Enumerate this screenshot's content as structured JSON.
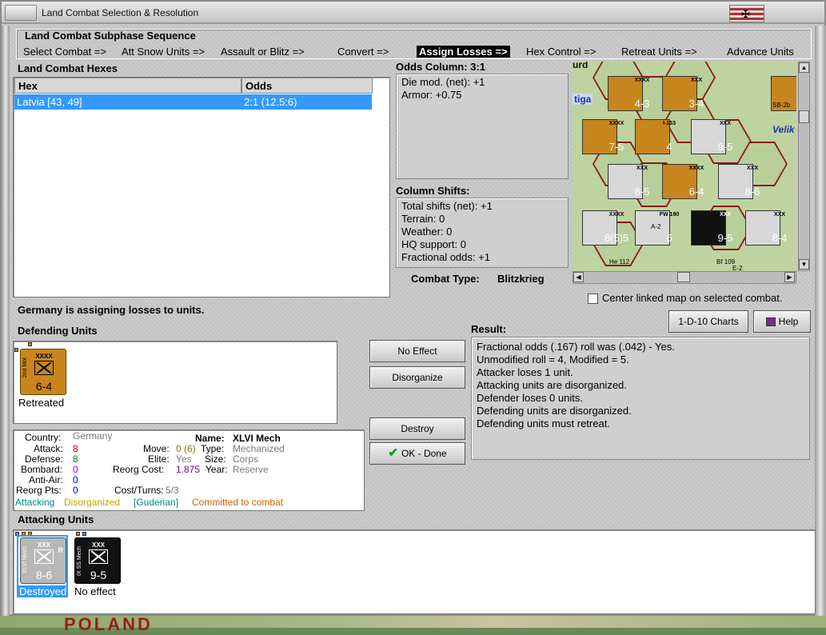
{
  "window": {
    "title": "Land Combat Selection & Resolution",
    "flag_symbol": "✠"
  },
  "sequence": {
    "title": "Land Combat Subphase Sequence",
    "steps": [
      "Select Combat =>",
      "Att Snow Units =>",
      "Assault or Blitz =>",
      "Convert =>",
      "Assign Losses =>",
      "Hex Control =>",
      "Retreat Units =>",
      "Advance Units"
    ],
    "active_step": "Assign Losses =>"
  },
  "hexes": {
    "title": "Land Combat Hexes",
    "columns": [
      "Hex",
      "Odds"
    ],
    "rows": [
      {
        "hex": "Latvia [43, 49]",
        "odds": "2:1 (12.5:6)"
      }
    ]
  },
  "odds": {
    "title": "Odds Column: 3:1",
    "lines": [
      "Die mod. (net): +1",
      "Armor: +0.75"
    ]
  },
  "shifts": {
    "title": "Column Shifts:",
    "lines": [
      "Total shifts (net): +1",
      "Terrain: 0",
      "Weather: 0",
      "HQ support: 0",
      "Fractional odds: +1"
    ]
  },
  "combat_type": {
    "label": "Combat Type:",
    "value": "Blitzkrieg"
  },
  "status_message": "Germany is assigning losses to units.",
  "map": {
    "center_checkbox_label": "Center linked map on selected combat.",
    "place_labels": [
      "Velik",
      "tiga",
      "urd"
    ],
    "units": [
      {
        "type": "XXXX",
        "value": "4-3",
        "color": "#c8861e"
      },
      {
        "type": "XXX",
        "value": "3-4",
        "color": "#c8861e"
      },
      {
        "type": "XXX",
        "value": "2",
        "color": "#c8861e"
      },
      {
        "type": "XXXX",
        "value": "7-5",
        "color": "#c8861e"
      },
      {
        "type": "I-153",
        "value": "4",
        "color": "#c8861e"
      },
      {
        "type": "XXX",
        "value": "9-5",
        "color": "#d8d8d8"
      },
      {
        "type": "XXX",
        "value": "8-5",
        "color": "#d8d8d8"
      },
      {
        "type": "XXXX",
        "value": "6-4",
        "color": "#c8861e"
      },
      {
        "type": "XXX",
        "value": "8-6",
        "color": "#d8d8d8"
      },
      {
        "type": "XXXX",
        "value": "8(5)5",
        "color": "#d8d8d8"
      },
      {
        "type": "FW 190",
        "value": "6",
        "color": "#d8d8d8"
      },
      {
        "type": "XXX",
        "value": "9-5",
        "color": "#111111"
      },
      {
        "type": "XXX",
        "value": "8-4",
        "color": "#d8d8d8"
      }
    ],
    "air_labels": [
      "He 112",
      "Bf 109",
      "A-2",
      "E-2",
      "SB-2b"
    ]
  },
  "buttons": {
    "charts": "1-D-10 Charts",
    "help": "Help",
    "no_effect": "No Effect",
    "disorganize": "Disorganize",
    "destroy": "Destroy",
    "ok_done": "OK - Done"
  },
  "defending": {
    "title": "Defending Units",
    "units": [
      {
        "top": "XXXX",
        "side": "2nd Mot",
        "value": "6-4",
        "status": "Retreated",
        "color": "#c8861e"
      }
    ]
  },
  "result": {
    "title": "Result:",
    "lines": [
      "Fractional odds (.167) roll was (.042)  - Yes.",
      "Unmodified roll = 4, Modified = 5.",
      "Attacker loses 1 unit.",
      "Attacking units are disorganized.",
      "Defender loses 0 units.",
      "Defending units are disorganized.",
      "Defending units must retreat."
    ]
  },
  "unit_details": {
    "country_label": "Country:",
    "country": "Germany",
    "name_label": "Name:",
    "name": "XLVI Mech",
    "attack_label": "Attack:",
    "attack": "8",
    "move_label": "Move:",
    "move": "0 (6)",
    "type_label": "Type:",
    "type": "Mechanized",
    "defense_label": "Defense:",
    "defense": "8",
    "elite_label": "Elite:",
    "elite": "Yes",
    "size_label": "Size:",
    "size": "Corps",
    "bombard_label": "Bombard:",
    "bombard": "0",
    "reorg_cost_label": "Reorg Cost:",
    "reorg_cost": "1.875",
    "year_label": "Year:",
    "year": "Reserve",
    "antiair_label": "Anti-Air:",
    "antiair": "0",
    "reorg_pts_label": "Reorg Pts:",
    "reorg_pts": "0",
    "cost_turns_label": "Cost/Turns:",
    "cost_turns": "5/3",
    "status_attacking": "Attacking",
    "status_disorganized": "Disorganized",
    "status_leader": "[Guderian]",
    "status_committed": "Committed to combat"
  },
  "attacking": {
    "title": "Attacking Units",
    "units": [
      {
        "top": "XXX",
        "side": "XLVI Mech",
        "value": "8-6",
        "status": "Destroyed",
        "color": "#b8b8b8",
        "corner": "R"
      },
      {
        "top": "XXX",
        "side": "IX SS Mech",
        "value": "9-5",
        "status": "No effect",
        "color": "#111111",
        "corner": ""
      }
    ]
  },
  "background_map_label": "POLAND"
}
